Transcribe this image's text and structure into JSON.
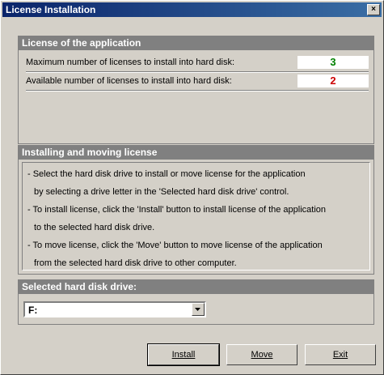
{
  "window": {
    "title": "License Installation",
    "close_glyph": "×"
  },
  "license_section": {
    "header": "License of the application",
    "rows": [
      {
        "label": "Maximum number of licenses to install into hard disk:",
        "value": "3",
        "value_color": "#008000"
      },
      {
        "label": "Available number of licenses to install into hard disk:",
        "value": "2",
        "value_color": "#cc0000"
      }
    ]
  },
  "install_section": {
    "header": "Installing and moving license",
    "lines": [
      "- Select the hard disk drive to install or move license for the application",
      "  by selecting a drive letter in the 'Selected hard disk drive' control.",
      "- To install license, click the 'Install' button to install license of the application",
      "  to the selected hard disk drive.",
      "- To move license, click the 'Move' button to move license of the application",
      "  from the selected hard disk drive to other computer."
    ]
  },
  "drive_section": {
    "header": "Selected hard disk drive:",
    "selected_drive": "F:"
  },
  "buttons": {
    "install": "Install",
    "move": "Move",
    "exit": "Exit"
  },
  "icons": {
    "close": "close-icon",
    "dropdown": "chevron-down-icon"
  }
}
